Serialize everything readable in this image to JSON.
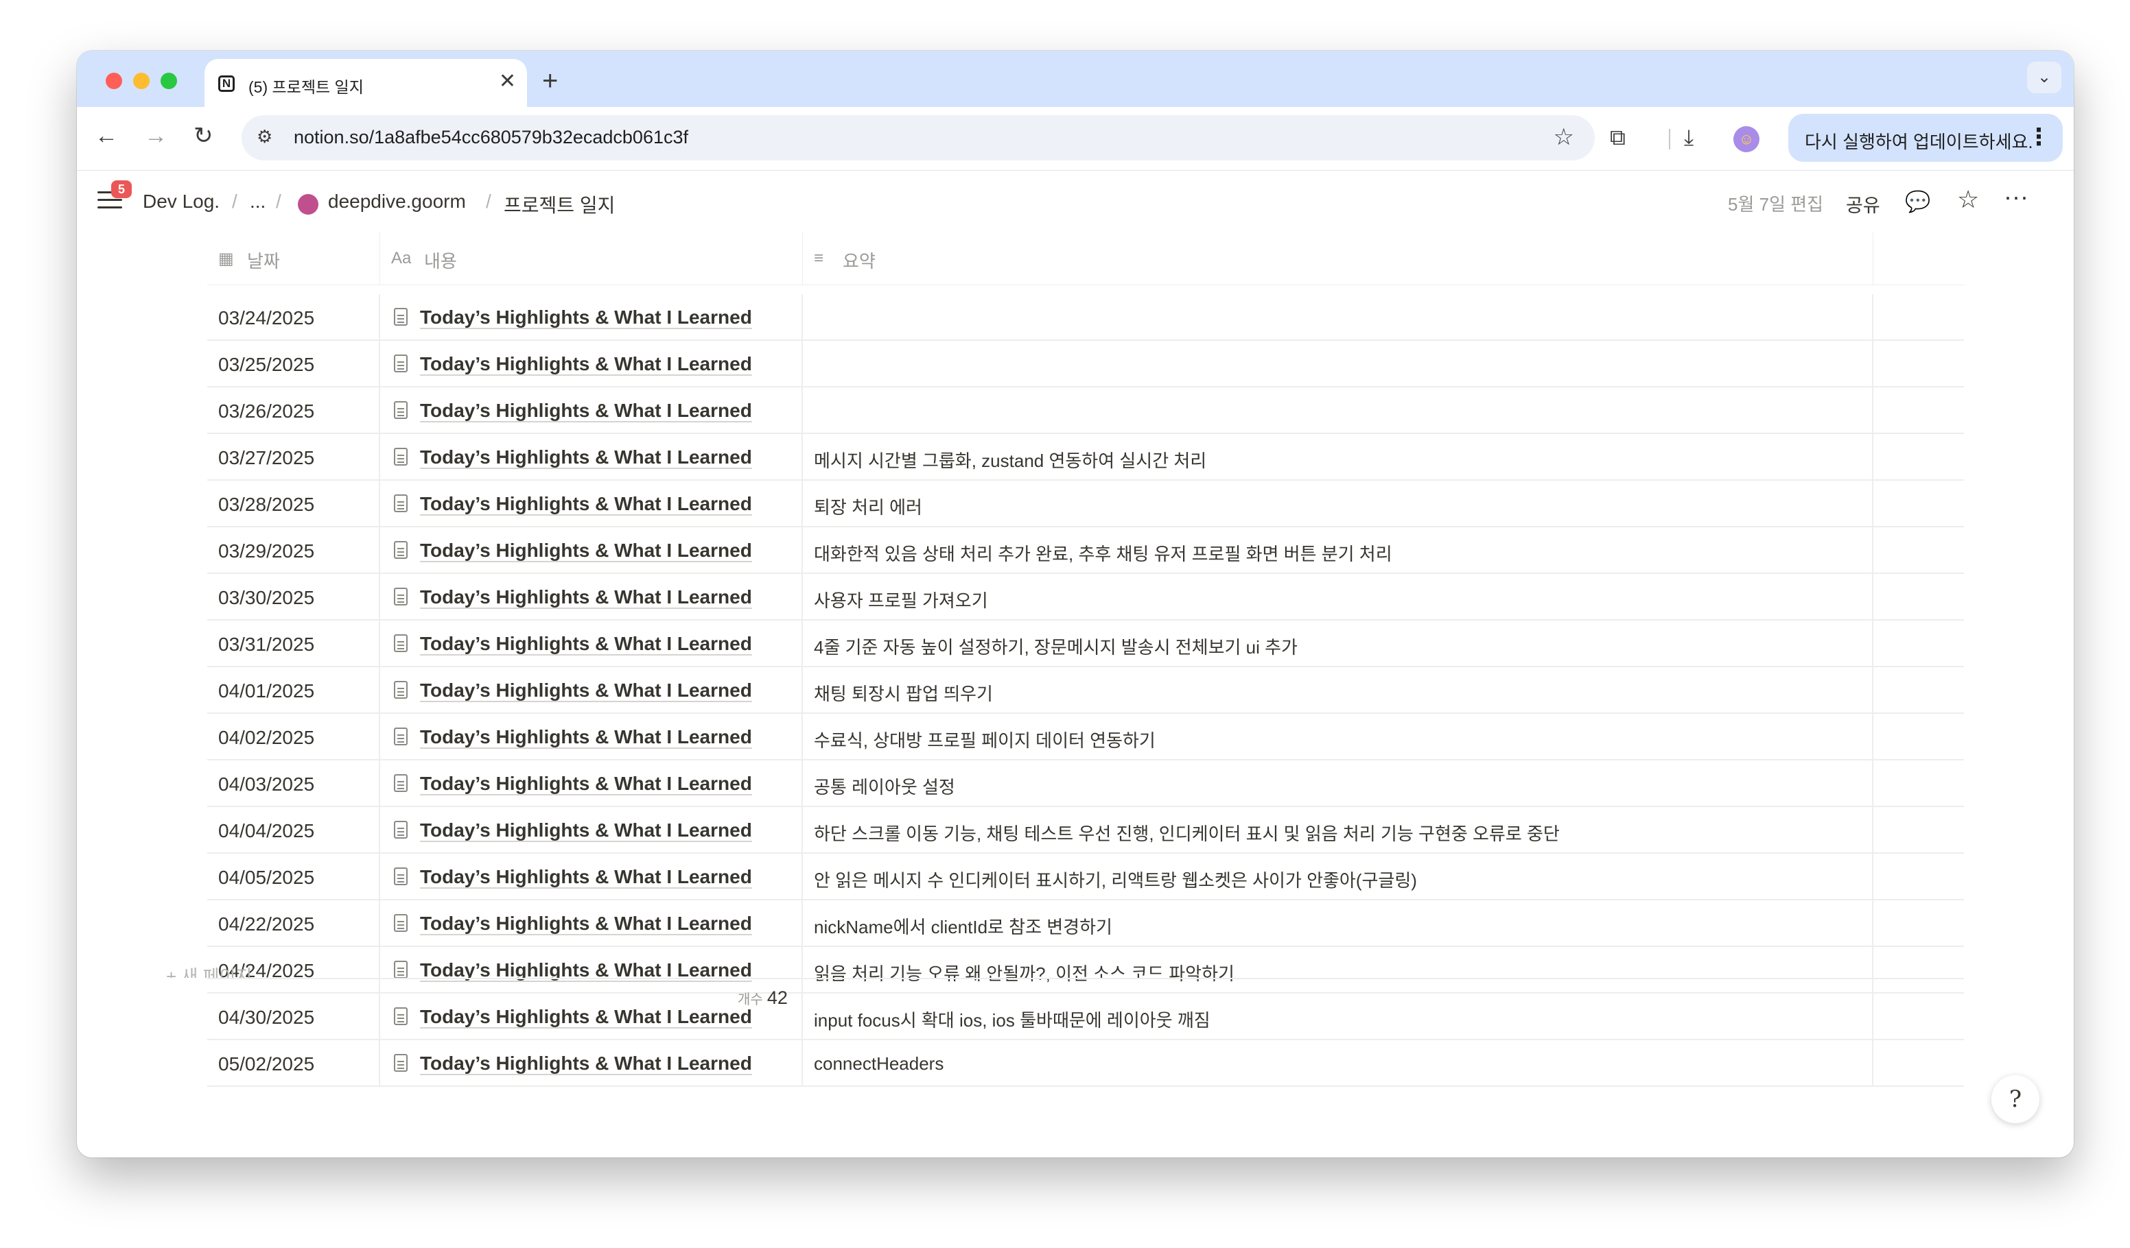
{
  "browser": {
    "tab_title": "(5) 프로젝트 일지",
    "favicon_letter": "N",
    "tab_close": "✕",
    "new_tab": "+",
    "tab_search": "⌄",
    "url": "notion.so/1a8afbe54cc680579b32ecadcb061c3f",
    "update_label": "다시 실행하여 업데이트하세요.",
    "icons": {
      "back": "←",
      "forward": "→",
      "reload": "↻",
      "site_settings": "⚙",
      "bookmark": "☆",
      "extensions": "⧉",
      "download": "⤓",
      "profile": "☺",
      "menu": "⋮"
    }
  },
  "notion_topbar": {
    "badge": "5",
    "breadcrumbs": [
      "Dev Log.",
      "...",
      "deepdive.goorm",
      "프로젝트 일지"
    ],
    "separator": "/",
    "edited": "5월 7일 편집",
    "share": "공유",
    "icons": {
      "comment": "💬",
      "favorite": "☆",
      "more": "···"
    }
  },
  "table": {
    "columns": [
      {
        "icon": "▦",
        "label": "날짜"
      },
      {
        "icon": "Aa",
        "label": "내용"
      },
      {
        "icon": "≡",
        "label": "요약"
      }
    ],
    "rows": [
      {
        "date": "03/24/2025",
        "title": "Today’s Highlights & What I Learned",
        "summary": ""
      },
      {
        "date": "03/25/2025",
        "title": "Today’s Highlights & What I Learned",
        "summary": ""
      },
      {
        "date": "03/26/2025",
        "title": "Today’s Highlights & What I Learned",
        "summary": ""
      },
      {
        "date": "03/27/2025",
        "title": "Today’s Highlights & What I Learned",
        "summary": "메시지 시간별 그룹화, zustand 연동하여 실시간 처리"
      },
      {
        "date": "03/28/2025",
        "title": "Today’s Highlights & What I Learned",
        "summary": "퇴장 처리 에러"
      },
      {
        "date": "03/29/2025",
        "title": "Today’s Highlights & What I Learned",
        "summary": "대화한적 있음 상태 처리 추가 완료, 추후 채팅 유저 프로필 화면 버튼 분기 처리"
      },
      {
        "date": "03/30/2025",
        "title": "Today’s Highlights & What I Learned",
        "summary": "사용자 프로필 가져오기"
      },
      {
        "date": "03/31/2025",
        "title": "Today’s Highlights & What I Learned",
        "summary": "4줄 기준 자동 높이 설정하기, 장문메시지 발송시 전체보기 ui 추가"
      },
      {
        "date": "04/01/2025",
        "title": "Today’s Highlights & What I Learned",
        "summary": "채팅 퇴장시 팝업 띄우기"
      },
      {
        "date": "04/02/2025",
        "title": "Today’s Highlights & What I Learned",
        "summary": "수료식, 상대방 프로필 페이지 데이터 연동하기"
      },
      {
        "date": "04/03/2025",
        "title": "Today’s Highlights & What I Learned",
        "summary": "공통 레이아웃 설정"
      },
      {
        "date": "04/04/2025",
        "title": "Today’s Highlights & What I Learned",
        "summary": "하단 스크롤 이동 기능, 채팅 테스트 우선 진행, 인디케이터 표시 및 읽음 처리 기능 구현중 오류로 중단"
      },
      {
        "date": "04/05/2025",
        "title": "Today’s Highlights & What I Learned",
        "summary": "안 읽은 메시지 수 인디케이터 표시하기, 리액트랑 웹소켓은 사이가 안좋아(구글링)"
      },
      {
        "date": "04/22/2025",
        "title": "Today’s Highlights & What I Learned",
        "summary": "nickName에서 clientId로 참조 변경하기"
      },
      {
        "date": "04/24/2025",
        "title": "Today’s Highlights & What I Learned",
        "summary": "읽음 처리 기능 오류 왜 안될까?, 이전 소스 코드 파악하기"
      },
      {
        "date": "04/30/2025",
        "title": "Today’s Highlights & What I Learned",
        "summary": "input focus시 확대 ios, ios 툴바때문에 레이아웃 깨짐"
      },
      {
        "date": "05/02/2025",
        "title": "Today’s Highlights & What I Learned",
        "summary": "connectHeaders"
      }
    ],
    "new_page": "+ 새 페이지",
    "count_label": "개수",
    "count_value": "42"
  },
  "help_button": "?"
}
